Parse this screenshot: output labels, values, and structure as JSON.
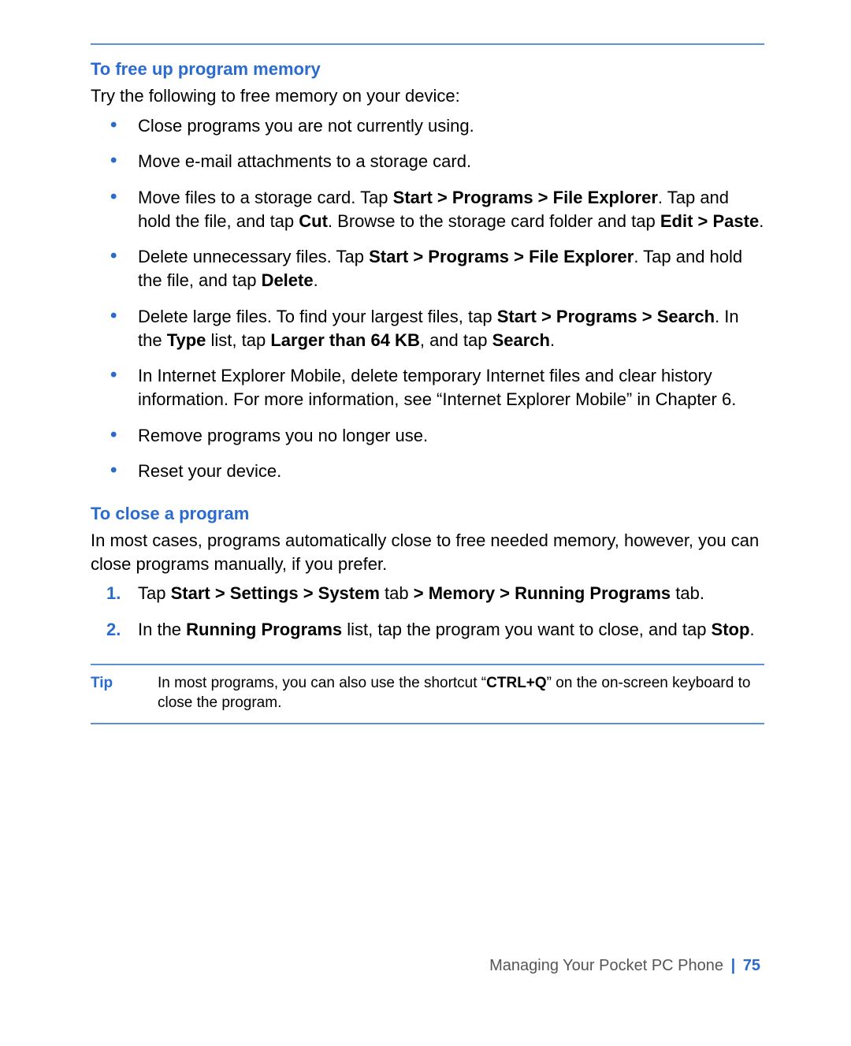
{
  "section1": {
    "heading": "To free up program memory",
    "intro": "Try the following to free memory on your device:",
    "bullets": [
      {
        "t0": "Close programs you are not currently using."
      },
      {
        "t0": "Move e-mail attachments to a storage card."
      },
      {
        "t0": "Move files to a storage card. Tap ",
        "b0": "Start > Programs > File Explorer",
        "t1": ". Tap and hold the file, and tap ",
        "b1": "Cut",
        "t2": ". Browse to the storage card folder and tap ",
        "b2": "Edit > Paste",
        "t3": "."
      },
      {
        "t0": "Delete unnecessary files. Tap ",
        "b0": "Start > Programs > File Explorer",
        "t1": ". Tap and hold the file, and tap ",
        "b1": "Delete",
        "t2": "."
      },
      {
        "t0": "Delete large files. To find your largest files, tap ",
        "b0": "Start > Programs > Search",
        "t1": ". In the ",
        "b1": "Type",
        "t2": " list, tap ",
        "b2": "Larger than 64 KB",
        "t3": ", and tap ",
        "b3": "Search",
        "t4": "."
      },
      {
        "t0": "In Internet Explorer Mobile, delete temporary Internet files and clear history information. For more information, see “Internet Explorer Mobile” in Chapter 6."
      },
      {
        "t0": "Remove programs you no longer use."
      },
      {
        "t0": "Reset your device."
      }
    ]
  },
  "section2": {
    "heading": "To close a program",
    "intro": "In most cases, programs automatically close to free needed memory, however, you can close programs manually, if you prefer.",
    "steps": [
      {
        "t0": "Tap ",
        "b0": "Start > Settings > System",
        "t1": " tab ",
        "b1": "> Memory > Running Programs",
        "t2": " tab."
      },
      {
        "t0": "In the ",
        "b0": "Running Programs",
        "t1": " list, tap the program you want to close, and tap ",
        "b1": "Stop",
        "t2": "."
      }
    ]
  },
  "tip": {
    "label": "Tip",
    "t0": "In most programs, you can also use the shortcut “",
    "b0": "CTRL+Q",
    "t1": "” on the on-screen keyboard to close the program."
  },
  "footer": {
    "chapter": "Managing Your Pocket PC Phone",
    "sep": "|",
    "page": "75"
  }
}
